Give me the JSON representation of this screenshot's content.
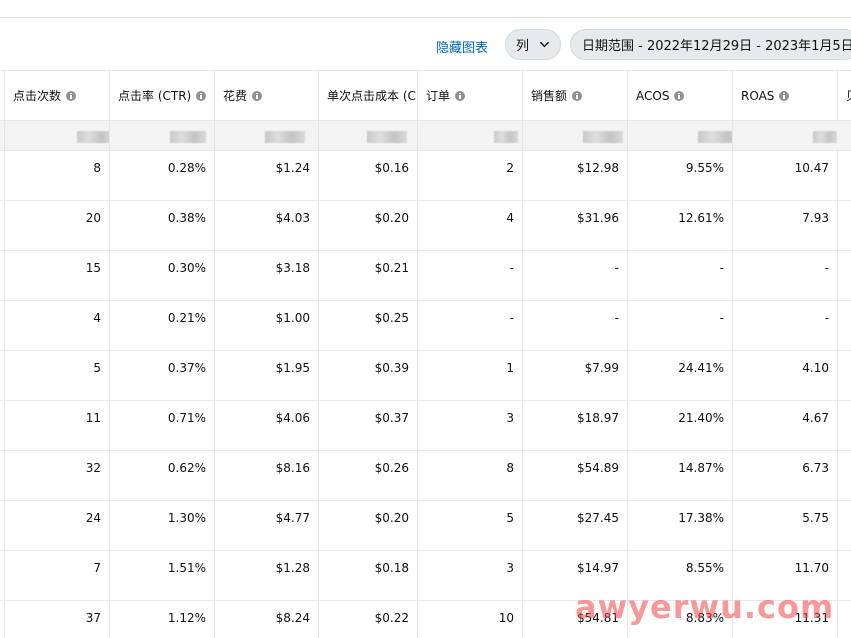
{
  "toolbar": {
    "hide_chart": "隐藏图表",
    "columns_label": "列",
    "date_range": "日期范围 - 2022年12月29日 - 2023年1月5日"
  },
  "columns": [
    {
      "key": "clicks",
      "label": "点击次数"
    },
    {
      "key": "ctr",
      "label": "点击率 (CTR)"
    },
    {
      "key": "spend",
      "label": "花费"
    },
    {
      "key": "cpc",
      "label": "单次点击成本 (CPC)"
    },
    {
      "key": "orders",
      "label": "订单"
    },
    {
      "key": "sales",
      "label": "销售额"
    },
    {
      "key": "acos",
      "label": "ACOS"
    },
    {
      "key": "roas",
      "label": "ROAS"
    },
    {
      "key": "next",
      "label": "贝"
    }
  ],
  "rows": [
    [
      "8",
      "0.28%",
      "$1.24",
      "$0.16",
      "2",
      "$12.98",
      "9.55%",
      "10.47"
    ],
    [
      "20",
      "0.38%",
      "$4.03",
      "$0.20",
      "4",
      "$31.96",
      "12.61%",
      "7.93"
    ],
    [
      "15",
      "0.30%",
      "$3.18",
      "$0.21",
      "-",
      "-",
      "-",
      "-"
    ],
    [
      "4",
      "0.21%",
      "$1.00",
      "$0.25",
      "-",
      "-",
      "-",
      "-"
    ],
    [
      "5",
      "0.37%",
      "$1.95",
      "$0.39",
      "1",
      "$7.99",
      "24.41%",
      "4.10"
    ],
    [
      "11",
      "0.71%",
      "$4.06",
      "$0.37",
      "3",
      "$18.97",
      "21.40%",
      "4.67"
    ],
    [
      "32",
      "0.62%",
      "$8.16",
      "$0.26",
      "8",
      "$54.89",
      "14.87%",
      "6.73"
    ],
    [
      "24",
      "1.30%",
      "$4.77",
      "$0.20",
      "5",
      "$27.45",
      "17.38%",
      "5.75"
    ],
    [
      "7",
      "1.51%",
      "$1.28",
      "$0.18",
      "3",
      "$14.97",
      "8.55%",
      "11.70"
    ],
    [
      "37",
      "1.12%",
      "$8.24",
      "$0.22",
      "10",
      "$54.81",
      "8.83%",
      "11.31"
    ]
  ],
  "watermark": "awyerwu.com"
}
